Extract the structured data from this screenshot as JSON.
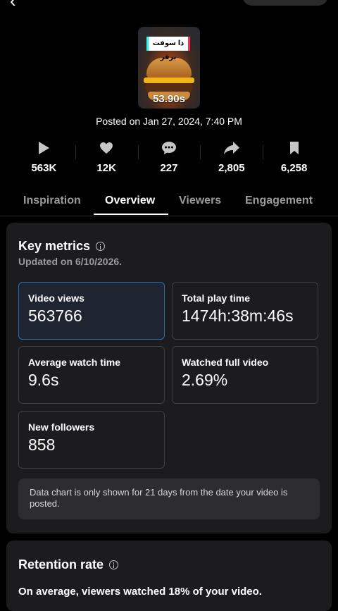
{
  "video": {
    "overlay_text": "ذا سوفت برقر",
    "duration": "53.90s",
    "posted": "Posted on Jan 27, 2024, 7:40 PM"
  },
  "stats": [
    {
      "icon": "play-icon",
      "value": "563K"
    },
    {
      "icon": "heart-icon",
      "value": "12K"
    },
    {
      "icon": "comment-icon",
      "value": "227"
    },
    {
      "icon": "share-icon",
      "value": "2,805"
    },
    {
      "icon": "bookmark-icon",
      "value": "6,258"
    }
  ],
  "tabs": [
    "Inspiration",
    "Overview",
    "Viewers",
    "Engagement"
  ],
  "active_tab": "Overview",
  "key_metrics": {
    "title": "Key metrics",
    "updated": "Updated on 6/10/2026.",
    "items": [
      {
        "label": "Video views",
        "value": "563766"
      },
      {
        "label": "Total play time",
        "value": "1474h:38m:46s"
      },
      {
        "label": "Average watch time",
        "value": "9.6s"
      },
      {
        "label": "Watched full video",
        "value": "2.69%"
      },
      {
        "label": "New followers",
        "value": "858"
      }
    ],
    "notice": "Data chart is only shown for 21 days from the date your video is posted."
  },
  "retention": {
    "title": "Retention rate",
    "summary": "On average, viewers watched 18% of your video."
  },
  "colors": {
    "background": "#000000",
    "card": "#1c1c1e",
    "selected_border": "#2a6ea8",
    "muted_text": "#9b9b9e"
  }
}
